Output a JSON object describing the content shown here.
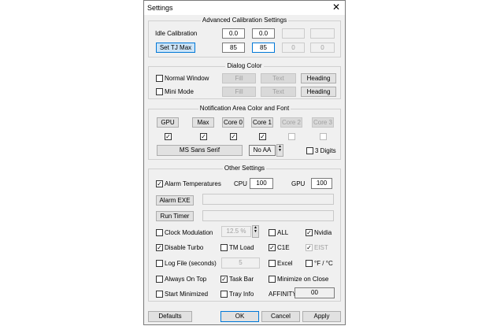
{
  "window": {
    "title": "Settings",
    "close": "✕"
  },
  "calib": {
    "caption": "Advanced Calibration Settings",
    "idle_label": "Idle Calibration",
    "idle_vals": [
      "0.0",
      "0.0",
      "",
      ""
    ],
    "tjmax_button": "Set TJ Max",
    "tjmax_vals": [
      "85",
      "85",
      "0",
      "0"
    ]
  },
  "dialog_color": {
    "caption": "Dialog Color",
    "normal_window": "Normal Window",
    "mini_mode": "Mini Mode",
    "fill": "Fill",
    "text": "Text",
    "heading": "Heading",
    "normal_checked": false,
    "mini_checked": false
  },
  "notif": {
    "caption": "Notification Area Color and Font",
    "buttons": [
      "GPU",
      "Max",
      "Core 0",
      "Core 1",
      "Core 2",
      "Core 3"
    ],
    "checks": [
      true,
      true,
      true,
      true,
      false,
      false
    ],
    "font_button": "MS Sans Serif",
    "aa_value": "No AA",
    "digits_label": "3 Digits",
    "digits_checked": false
  },
  "other": {
    "caption": "Other Settings",
    "alarm_label": "Alarm Temperatures",
    "alarm_checked": true,
    "cpu_label": "CPU",
    "cpu_value": "100",
    "gpu_label": "GPU",
    "gpu_value": "100",
    "alarm_exe_button": "Alarm EXE",
    "alarm_exe_value": "",
    "run_timer_button": "Run Timer",
    "run_timer_value": "",
    "clock_mod_label": "Clock Modulation",
    "clock_mod_checked": false,
    "clock_mod_value": "12.5 %",
    "disable_turbo_label": "Disable Turbo",
    "disable_turbo_checked": true,
    "log_file_label": "Log File (seconds)",
    "log_file_checked": false,
    "log_file_value": "5",
    "always_on_top_label": "Always On Top",
    "always_on_top_checked": false,
    "start_minimized_label": "Start Minimized",
    "start_minimized_checked": false,
    "all_label": "ALL",
    "all_checked": false,
    "tm_load_label": "TM Load",
    "tm_load_checked": false,
    "excel_label": "Excel",
    "excel_checked": false,
    "task_bar_label": "Task Bar",
    "task_bar_checked": true,
    "tray_info_label": "Tray Info",
    "tray_info_checked": false,
    "nvidia_label": "Nvidia",
    "nvidia_checked": true,
    "c1e_label": "C1E",
    "c1e_checked": true,
    "eist_label": "EIST",
    "eist_checked": true,
    "fc_label": "°F / °C",
    "fc_checked": false,
    "minimize_on_close_label": "Minimize on Close",
    "minimize_on_close_checked": false,
    "affinity_label": "AFFINITY",
    "affinity_value": "00"
  },
  "footer": {
    "defaults": "Defaults",
    "ok": "OK",
    "cancel": "Cancel",
    "apply": "Apply"
  }
}
